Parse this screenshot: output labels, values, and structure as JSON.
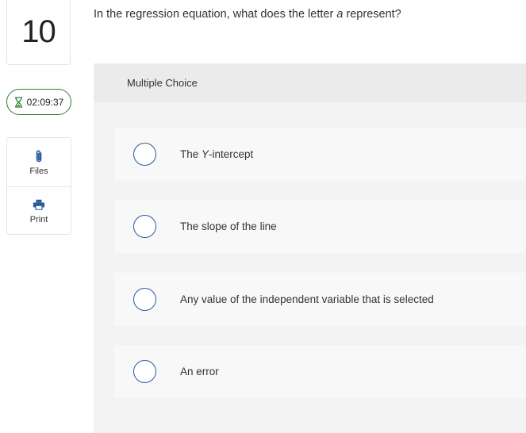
{
  "question_number": "10",
  "timer": "02:09:37",
  "tools": [
    {
      "label": "Files",
      "icon": "paperclip-icon"
    },
    {
      "label": "Print",
      "icon": "printer-icon"
    }
  ],
  "question": {
    "before": "In the regression equation, what does the letter ",
    "emphasis": "a",
    "after": " represent?"
  },
  "multiple_choice": {
    "header": "Multiple Choice",
    "choices": [
      {
        "prefix": "The ",
        "emphasis": "Y",
        "suffix": "-intercept"
      },
      {
        "prefix": "The slope of the line",
        "emphasis": "",
        "suffix": ""
      },
      {
        "prefix": "Any value of the independent variable that is selected",
        "emphasis": "",
        "suffix": ""
      },
      {
        "prefix": "An error",
        "emphasis": "",
        "suffix": ""
      }
    ]
  },
  "colors": {
    "accent": "#2a5d9f",
    "timer_border": "#2e7d32",
    "panel_bg": "#f3f3f3",
    "header_bg": "#ebebeb",
    "choice_bg": "#f8f8f8"
  }
}
